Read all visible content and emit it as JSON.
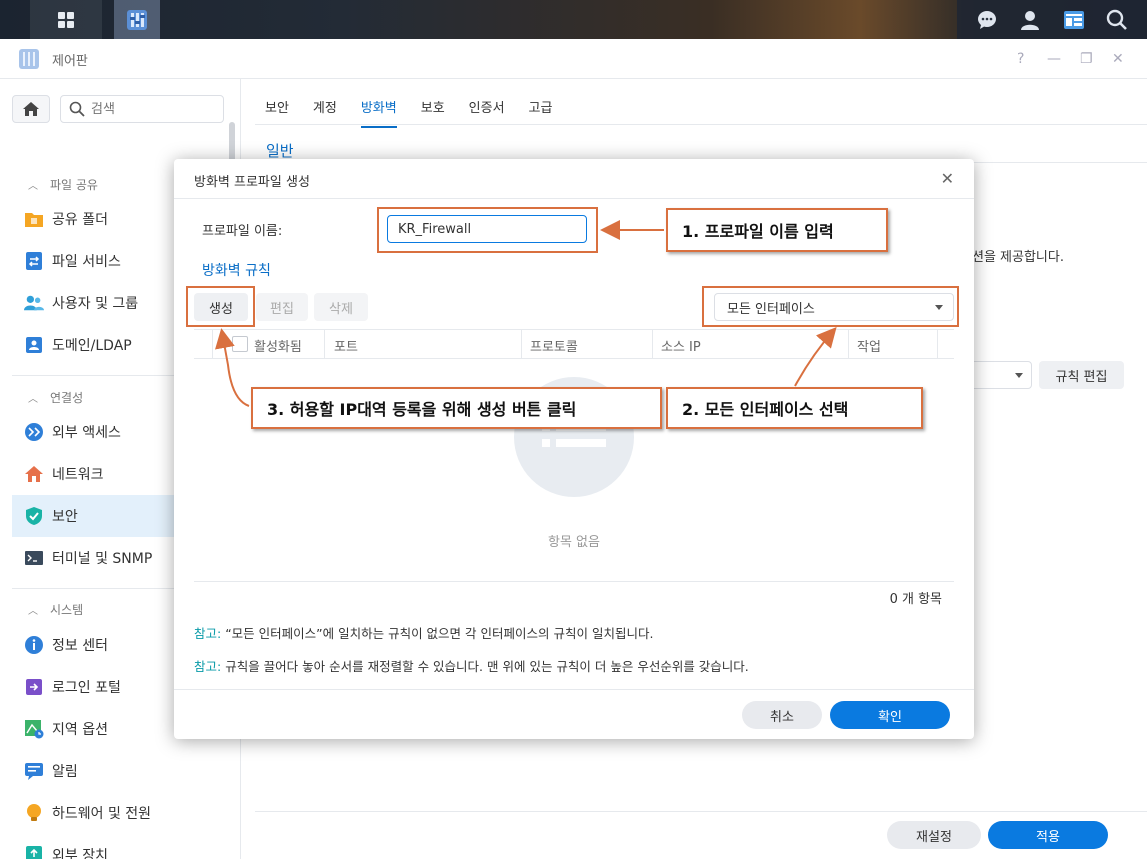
{
  "taskbar": {
    "icons": [
      "grid-icon",
      "control-panel-icon",
      "chat-icon",
      "user-icon",
      "widget-icon",
      "search-icon"
    ]
  },
  "window": {
    "title": "제어판",
    "controls": [
      "?",
      "—",
      "❐",
      "✕"
    ]
  },
  "sidebar": {
    "search_placeholder": "검색",
    "sections": [
      {
        "title": "파일 공유",
        "items": [
          "공유 폴더",
          "파일 서비스",
          "사용자 및 그룹",
          "도메인/LDAP"
        ]
      },
      {
        "title": "연결성",
        "items": [
          "외부 액세스",
          "네트워크",
          "보안",
          "터미널 및 SNMP"
        ]
      },
      {
        "title": "시스템",
        "items": [
          "정보 센터",
          "로그인 포털",
          "지역 옵션",
          "알림",
          "하드웨어 및 전원",
          "외부 장치"
        ]
      }
    ],
    "active_item": "보안"
  },
  "main": {
    "tabs": [
      "보안",
      "계정",
      "방화벽",
      "보호",
      "인증서",
      "고급"
    ],
    "active_tab": "방화벽",
    "section_title": "일반",
    "desc_fragment": "션을 제공합니다.",
    "rule_edit_button": "규칙 편집",
    "reset_button": "재설정",
    "apply_button": "적용"
  },
  "dialog": {
    "title": "방화벽 프로파일 생성",
    "close": "✕",
    "profile_name_label": "프로파일 이름:",
    "profile_name_value": "KR_Firewall",
    "rules_title": "방화벽 규칙",
    "toolbar": {
      "create": "생성",
      "edit": "편집",
      "delete": "삭제"
    },
    "interface_select": "모든 인터페이스",
    "columns": [
      "활성화됨",
      "포트",
      "프로토콜",
      "소스 IP",
      "작업"
    ],
    "empty_text": "항목 없음",
    "count_text": "0 개 항목",
    "notes": [
      {
        "label": "참고:",
        "text": "“모든 인터페이스”에 일치하는 규칙이 없으면 각 인터페이스의 규칙이 일치됩니다."
      },
      {
        "label": "참고:",
        "text": "규칙을 끌어다 놓아 순서를 재정렬할 수 있습니다. 맨 위에 있는 규칙이 더 높은 우선순위를 갖습니다."
      }
    ],
    "cancel_button": "취소",
    "ok_button": "확인"
  },
  "annotations": {
    "callout1": "1. 프로파일 이름 입력",
    "callout2": "2. 모든 인터페이스 선택",
    "callout3": "3. 허용할 IP대역 등록을 위해 생성 버튼 클릭",
    "color": "#d9703f"
  },
  "colors": {
    "accent": "#0a6ec7",
    "primary_button": "#0a7ae0",
    "active_nav_bg": "#e3f0fb",
    "note_label": "#0a9ba8"
  }
}
